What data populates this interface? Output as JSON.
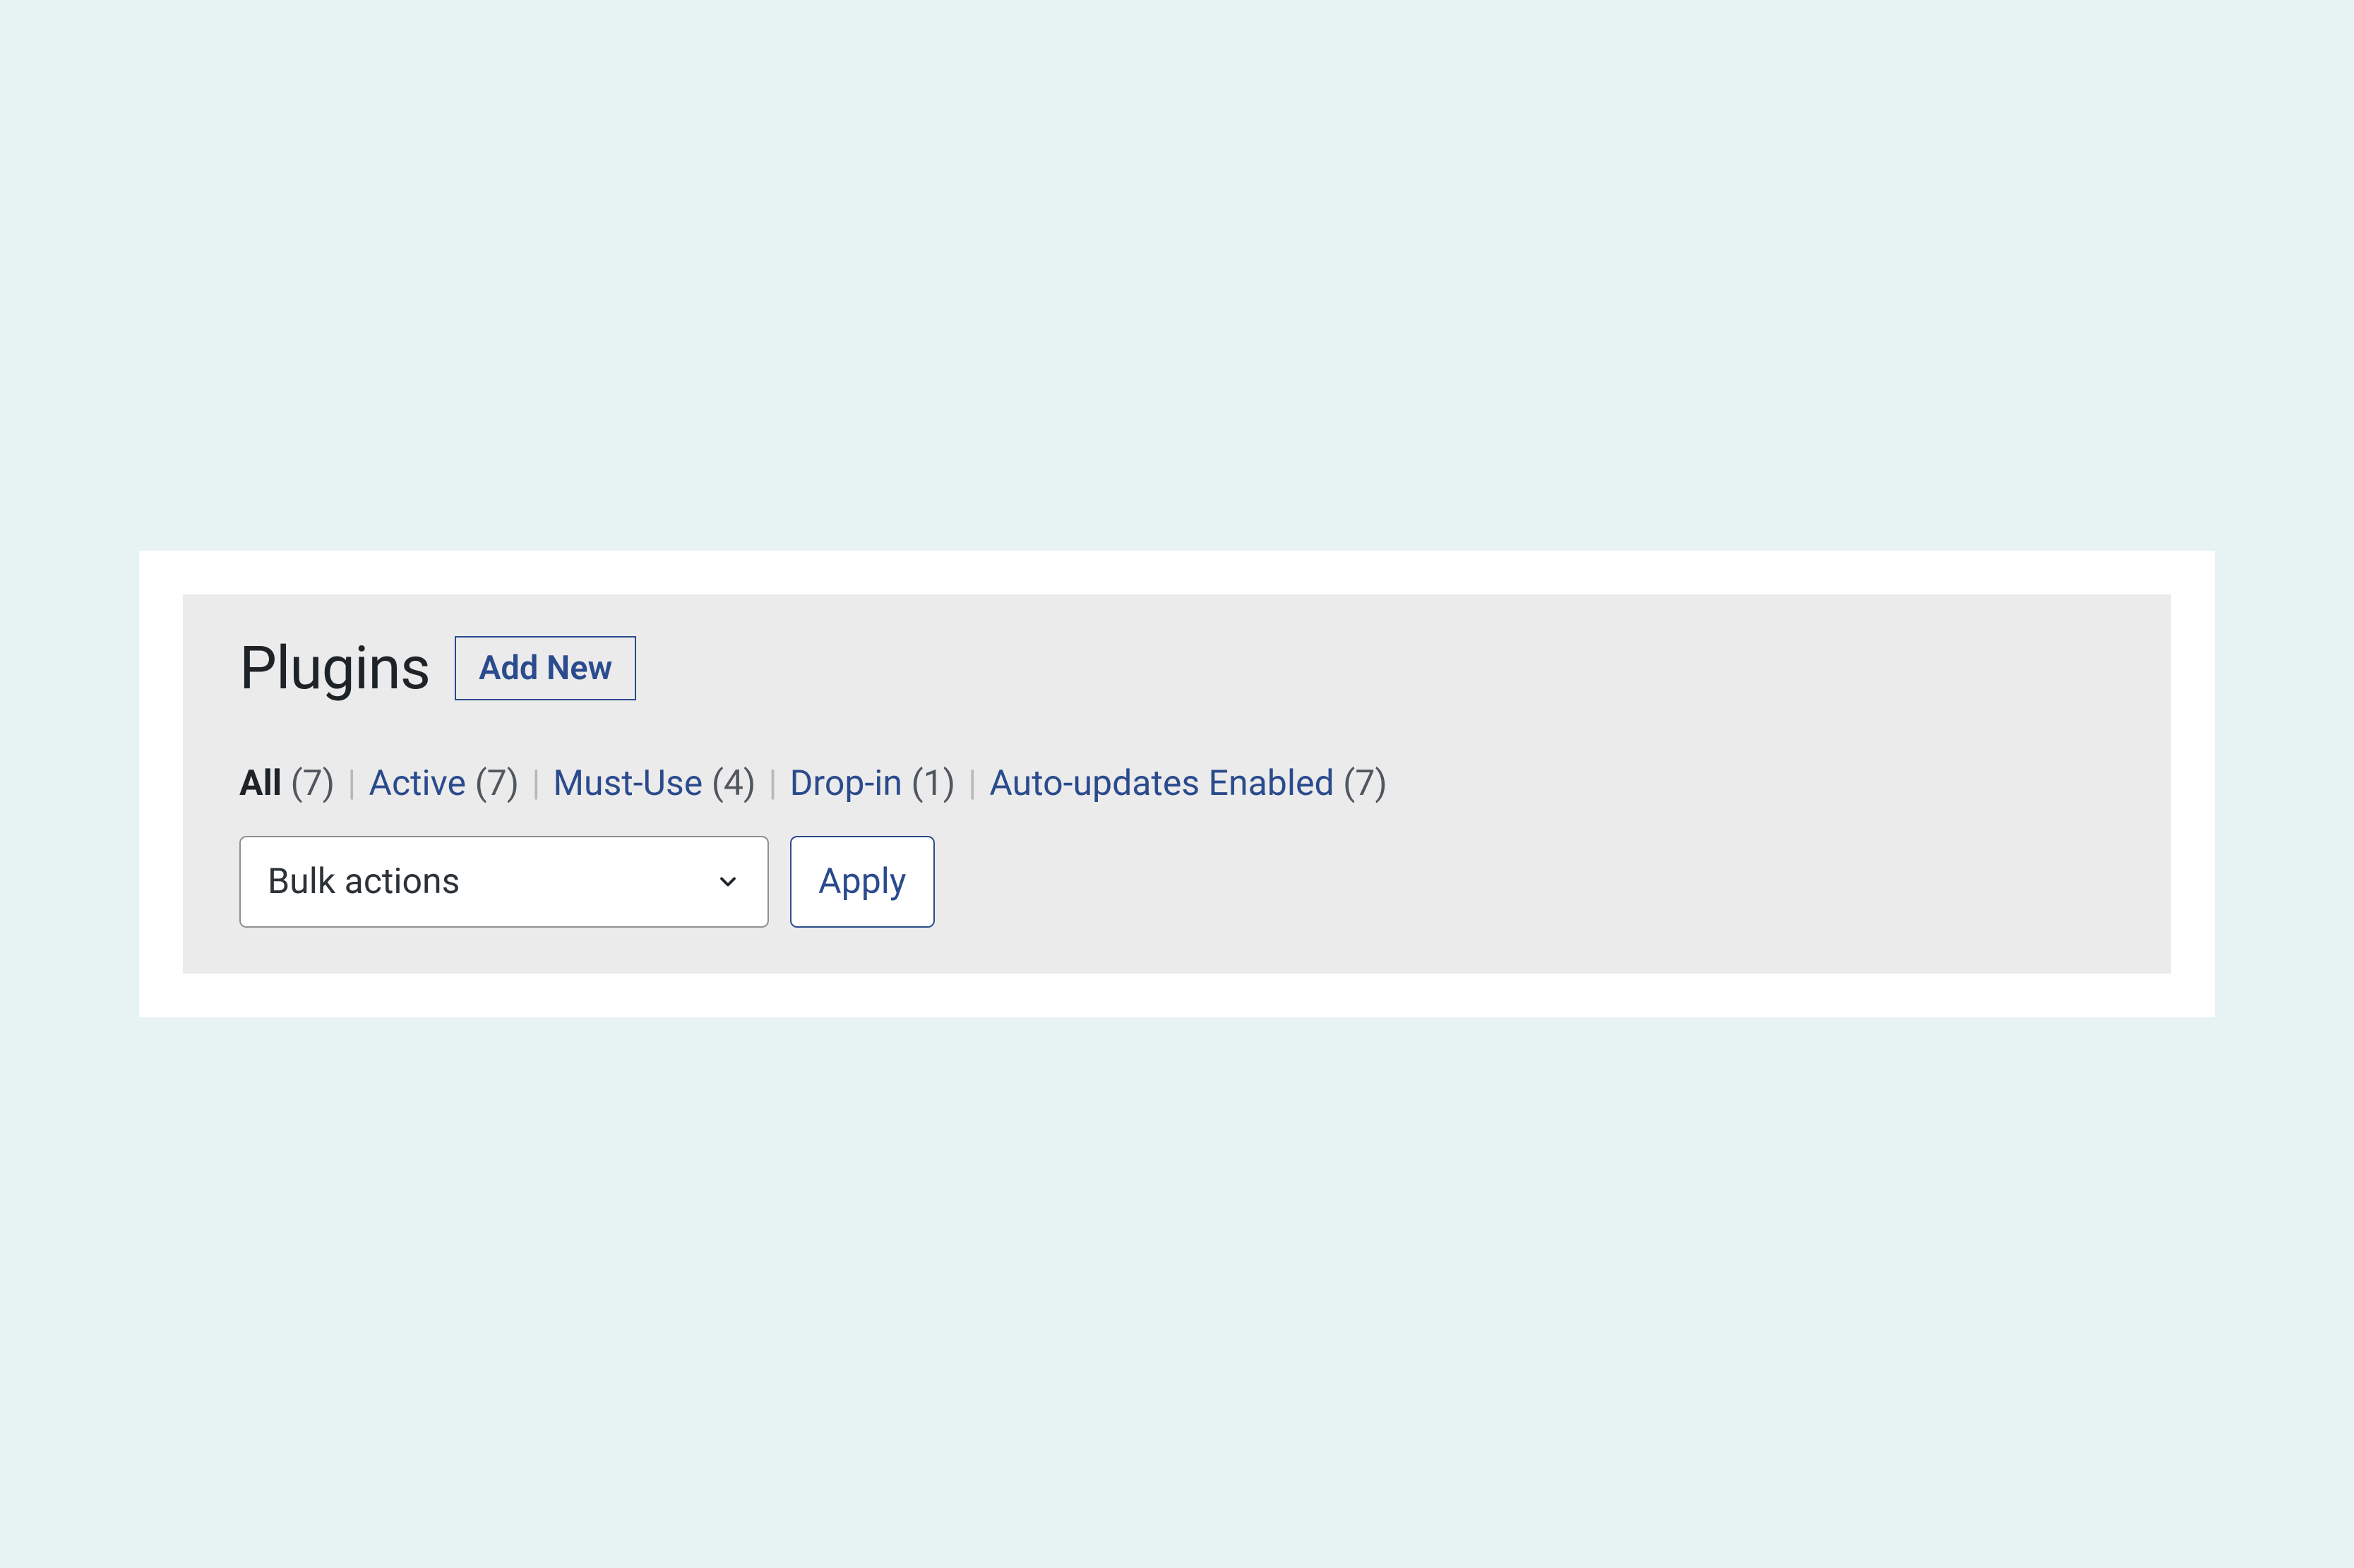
{
  "header": {
    "title": "Plugins",
    "add_new_label": "Add New"
  },
  "filters": {
    "items": [
      {
        "label": "All",
        "count": 7,
        "active": true
      },
      {
        "label": "Active",
        "count": 7,
        "active": false
      },
      {
        "label": "Must-Use",
        "count": 4,
        "active": false
      },
      {
        "label": "Drop-in",
        "count": 1,
        "active": false
      },
      {
        "label": "Auto-updates Enabled",
        "count": 7,
        "active": false
      }
    ]
  },
  "bulk": {
    "selected": "Bulk actions",
    "apply_label": "Apply"
  }
}
